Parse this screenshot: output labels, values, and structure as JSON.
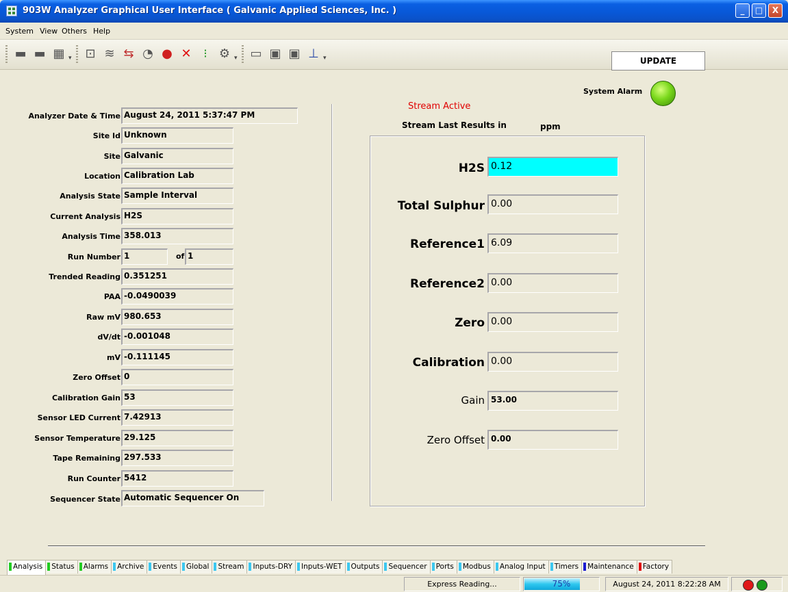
{
  "window": {
    "title": "903W Analyzer Graphical User Interface  ( Galvanic Applied Sciences, Inc. )",
    "minimize": "_",
    "maximize": "□",
    "close": "X"
  },
  "menu": {
    "items": [
      "System",
      "View",
      "Others",
      "Help"
    ]
  },
  "toolbar": {
    "update_label": "UPDATE",
    "sep_glyph": "▾",
    "icons": [
      "unit-icon",
      "unit-icon",
      "module-icon",
      "config-icon",
      "chart-icon",
      "transfer-icon",
      "gauge-icon",
      "valve-icon",
      "disable-icon",
      "signal-icon",
      "tools-icon",
      "open-folder-icon",
      "save-icon",
      "save-as-icon",
      "plot-icon"
    ]
  },
  "fields": [
    {
      "label": "Analyzer Date & Time",
      "value": "August 24, 2011 5:37:47 PM"
    },
    {
      "label": "Site Id",
      "value": "Unknown"
    },
    {
      "label": "Site",
      "value": "Galvanic"
    },
    {
      "label": "Location",
      "value": "Calibration Lab"
    },
    {
      "label": "Analysis State",
      "value": "Sample Interval"
    },
    {
      "label": "Current Analysis",
      "value": "H2S"
    },
    {
      "label": "Analysis Time",
      "value": "358.013"
    },
    {
      "label": "Run Number",
      "value": "1"
    },
    {
      "label": "Trended Reading",
      "value": "0.351251"
    },
    {
      "label": "PAA",
      "value": "-0.0490039"
    },
    {
      "label": "Raw mV",
      "value": "980.653"
    },
    {
      "label": "dV/dt",
      "value": "-0.001048"
    },
    {
      "label": "mV",
      "value": "-0.111145"
    },
    {
      "label": "Zero Offset",
      "value": "0"
    },
    {
      "label": "Calibration Gain",
      "value": "53"
    },
    {
      "label": "Sensor LED Current",
      "value": "7.42913"
    },
    {
      "label": "Sensor Temperature",
      "value": "29.125"
    },
    {
      "label": "Tape Remaining",
      "value": "297.533"
    },
    {
      "label": "Run Counter",
      "value": "5412"
    },
    {
      "label": "Sequencer State",
      "value": "Automatic Sequencer On"
    }
  ],
  "run_of": {
    "label": "of",
    "value": "1"
  },
  "alarm": {
    "label": "System Alarm",
    "color": "#7ad81c"
  },
  "stream": {
    "status": "Stream Active",
    "results_title": "Stream Last Results in",
    "unit": "ppm"
  },
  "results": [
    {
      "label": "H2S",
      "value": "0.12"
    },
    {
      "label": "Total Sulphur",
      "value": "0.00"
    },
    {
      "label": "Reference1",
      "value": "6.09"
    },
    {
      "label": "Reference2",
      "value": "0.00"
    },
    {
      "label": "Zero",
      "value": "0.00"
    },
    {
      "label": "Calibration",
      "value": "0.00"
    },
    {
      "label": "Gain",
      "value": "53.00"
    },
    {
      "label": "Zero Offset",
      "value": "0.00"
    }
  ],
  "tabs": [
    {
      "label": "Analysis",
      "color": "#22cc22"
    },
    {
      "label": "Status",
      "color": "#22cc22"
    },
    {
      "label": "Alarms",
      "color": "#22cc22"
    },
    {
      "label": "Archive",
      "color": "#3cc8f0"
    },
    {
      "label": "Events",
      "color": "#3cc8f0"
    },
    {
      "label": "Global",
      "color": "#3cc8f0"
    },
    {
      "label": "Stream",
      "color": "#3cc8f0"
    },
    {
      "label": "Inputs-DRY",
      "color": "#3cc8f0"
    },
    {
      "label": "Inputs-WET",
      "color": "#3cc8f0"
    },
    {
      "label": "Outputs",
      "color": "#3cc8f0"
    },
    {
      "label": "Sequencer",
      "color": "#3cc8f0"
    },
    {
      "label": "Ports",
      "color": "#3cc8f0"
    },
    {
      "label": "Modbus",
      "color": "#3cc8f0"
    },
    {
      "label": "Analog Input",
      "color": "#3cc8f0"
    },
    {
      "label": "Timers",
      "color": "#3cc8f0"
    },
    {
      "label": "Maintenance",
      "color": "#1a1ad0"
    },
    {
      "label": "Factory",
      "color": "#e01010"
    }
  ],
  "statusbar": {
    "reading": "Express Reading...",
    "progress_text": "75%",
    "progress": 0.75,
    "datetime": "August 24, 2011 8:22:28 AM",
    "led_red": "#e01818",
    "led_green": "#1a9a1a"
  }
}
